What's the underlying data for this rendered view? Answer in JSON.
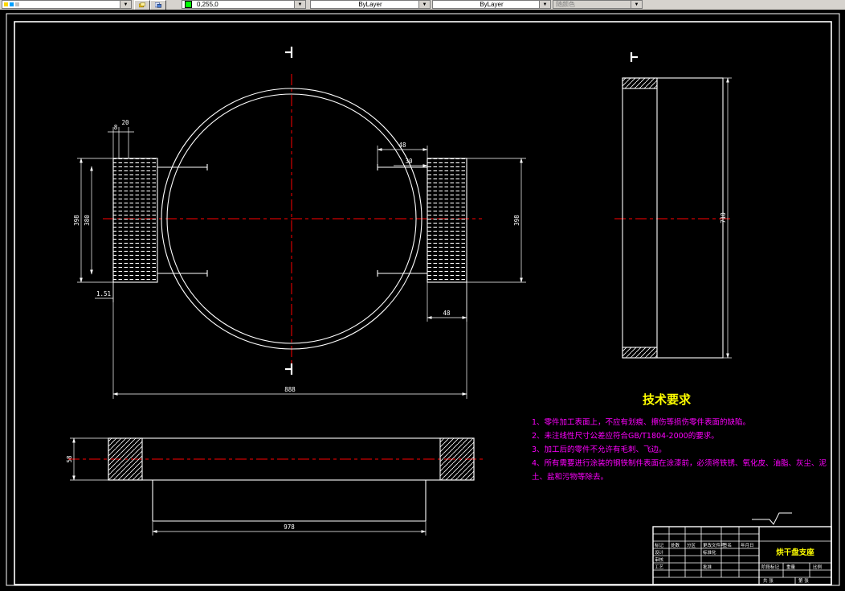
{
  "toolbar": {
    "layer_value": "",
    "color_value": "0,255,0",
    "linetype_value": "ByLayer",
    "lineweight_value": "ByLayer",
    "plotstyle_value": "随颜色"
  },
  "colors": {
    "centerline": "#ff0000",
    "outline": "#ffffff",
    "tech_title": "#ffff00",
    "tech_items": "#ff00ff",
    "part_name": "#ffff00",
    "toolbar_swatch": "#00ff00"
  },
  "tech_requirements": {
    "title": "技术要求",
    "line1": "1、零件加工表面上，不应有划痕、擦伤等损伤零件表面的缺陷。",
    "line2": "2、未注线性尺寸公差应符合GB/T1804-2000的要求。",
    "line3": "3、加工后的零件不允许有毛刺、飞边。",
    "line4a": "4、所有需要进行涂装的钢铁制件表面在涂漆前，必须将铁锈、氧化皮、油脂、灰尘、泥",
    "line4b": "土、盐和污物等除去。"
  },
  "dims": {
    "front_left_outer": "398",
    "front_left_inner": "380",
    "front_top_small1": "8",
    "front_top_small2": "20",
    "front_right_top1": "48",
    "front_right_top2": "30",
    "front_right_height": "398",
    "front_bottom_left": "1.51",
    "front_under_right": "48",
    "front_overall": "888",
    "side_height": "710",
    "bottom_left_height": "58",
    "bottom_width": "978"
  },
  "title_block": {
    "part_name": "烘干盘支座",
    "mark": "标记",
    "count": "处数",
    "zone": "分区",
    "change_file": "更改文件号",
    "sign": "签名",
    "date": "年月日",
    "design": "设计",
    "check": "审核",
    "process": "工艺",
    "standard": "标准化",
    "approve": "批准",
    "stage_mark": "阶段标记",
    "weight": "重量",
    "scale": "比例",
    "sheets": "共 张",
    "sheet_no": "第 张"
  }
}
